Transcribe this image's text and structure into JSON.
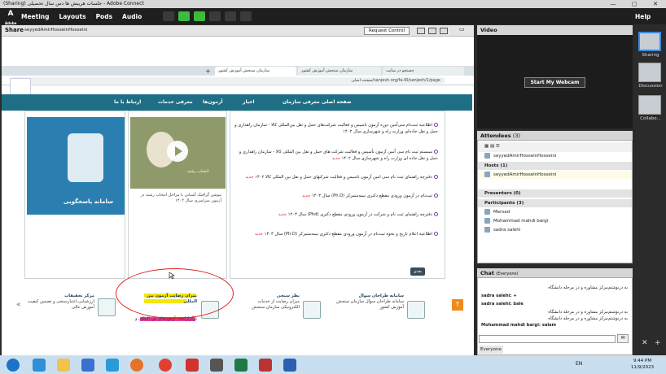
{
  "window": {
    "title": "(Sharing) جلسات هریبش ها دس سال تحصیلی - Adobe Connect",
    "minimize": "—",
    "maximize": "▢",
    "close": "✕"
  },
  "menubar": {
    "logo": "Adobe",
    "items": [
      "Meeting",
      "Layouts",
      "Pods",
      "Audio"
    ],
    "help": "Help"
  },
  "share": {
    "title": "Share",
    "presenter": "seyyedAmirHosseinHosseini",
    "request_control": "Request Control"
  },
  "browser": {
    "tabs": [
      "جستجو در سایت",
      "سازمان سنجش آموزش کشور",
      "سازمان سنجش آموزش کشور"
    ],
    "url": "sanjesh.org/fa-IR/sanjesh/1/page/صفحه-اصلی"
  },
  "site": {
    "nav": [
      "صفحه اصلی",
      "معرفی سازمان",
      "اخبار",
      "آزمون‌ها",
      "معرفی خدمات",
      "ارتباط با ما"
    ],
    "logo_text": "نظام آموزش",
    "news": [
      {
        "text": "اطلاعیه ثبت‌نام سی‌اُمین دوره آزمون تاسیس و فعالیت شرکت‌های حمل و نقل بین‌المللی کالا - سازمان راهداری و حمل و نقل جاده‌ای وزارت راه و شهرسازی سال ۱۴۰۲",
        "tag": ""
      },
      {
        "text": "سیستم ثبت نام سی اُمین آزمون تأسیس و فعالیت شرکت های حمل و نقل بین المللی کالا - سازمان راهداری و حمل و نقل جاده ای وزارت راه و شهرسازی سال ۱۴۰۲",
        "tag": "جدید"
      },
      {
        "text": "دفترچه راهنمای ثبت نام سی امین آزمون تاسیس و فعالیت شرکتهای حمل و نقل بین المللی کالا ۱۴۰۲",
        "tag": "جدید"
      },
      {
        "text": "ثبت‌نام در آزمون ورودی مقطع دکتری نیمه‌متمرکز (Ph.D) سال ۱۴۰۳",
        "tag": "جدید"
      },
      {
        "text": "دفترچه راهنمای ثبت نام و شرکت در آزمون ورودی مقطع دکتری (Phd) سال ۱۴۰۳",
        "tag": "جدید"
      },
      {
        "text": "اطلاعیه اعلام تاریخ و نحوه ثبت‌نام در آزمون ورودی مقطع دکتری نیمه‌متمرکز (Ph.D) سال ۱۴۰۳",
        "tag": "جدید"
      }
    ],
    "more": "بعدی",
    "video": {
      "thumb_label": "انتخاب رشته",
      "caption": "موشن گرافیک آشنایی با مراحل انتخاب رشته در آزمون سراسری سال ۱۴۰۲"
    },
    "samane": {
      "label": "سامانه پاسخگویی"
    },
    "bottom": [
      {
        "title": "سامانه طراحان سوال",
        "desc": "سامانه طراحان سوال سازمان سنجش آموزش کشور"
      },
      {
        "title": "نظر سنجی",
        "desc": "میزان رضایت از خدمات الکترونیکی سازمان سنجش"
      },
      {
        "title": "میزان رضایت آزمون بین المللی",
        "desc": "برگزارکننده آزمون‌های بین المللی و"
      },
      {
        "title": "مرکز تحقیقات",
        "desc": "ارزشیابی،اعتبارسنجی و تضمین کیفیت آموزش عالی"
      }
    ],
    "prev": "«",
    "next": "↑"
  },
  "video_pod": {
    "title": "Video",
    "webcam": "Start My Webcam"
  },
  "attendees": {
    "title": "Attendees",
    "count": "(3)",
    "me": "seyyedAmirHosseinHosseini",
    "hosts_label": "Hosts (1)",
    "hosts": [
      "seyyedAmirHosseinHosseini"
    ],
    "presenters_label": "Presenters (0)",
    "participants_label": "Participants (3)",
    "participants": [
      "Mersad",
      "Mohammad mahdi bargi",
      "sadra salehi"
    ]
  },
  "chat": {
    "title": "Chat",
    "scope": "(Everyone)",
    "messages": [
      "به درنوشتم‌مرکز مشاوره و در مرحله دانشگاه",
      "sadra salehi: +",
      "sadra salehi: bale",
      "به درنوشتم‌مرکز مشاوره و در مرحله دانشگاه",
      "به درنوشتم‌مرکز مشاوره و در مرحله دانشگاه",
      "Mohammad mahdi bargi: salam"
    ],
    "target": "Everyone"
  },
  "layouts": [
    "Sharing",
    "Discussion",
    "Collabo..."
  ],
  "taskbar": {
    "lang": "EN",
    "time": "9:44 PM",
    "date": "11/9/2023"
  },
  "colors": {
    "accent": "#1e6e86",
    "highlight": "#f5e60a",
    "highlight2": "#e040a0",
    "annotation": "#e02020"
  }
}
